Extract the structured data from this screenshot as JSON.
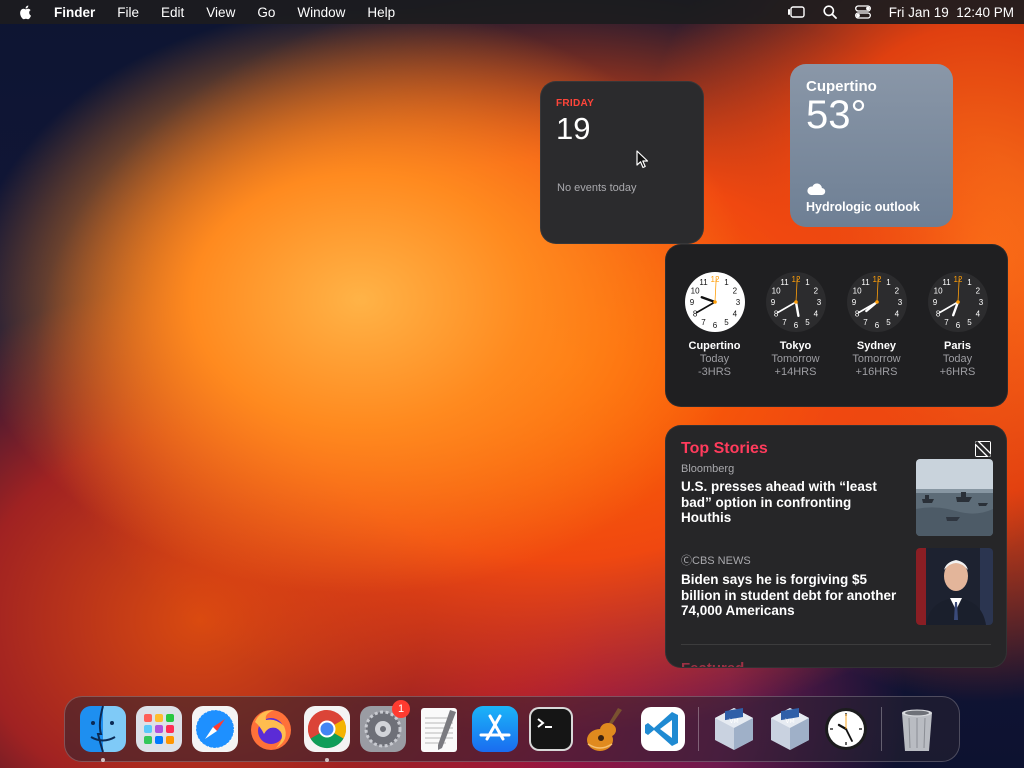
{
  "menubar": {
    "app_name": "Finder",
    "menus": [
      "File",
      "Edit",
      "View",
      "Go",
      "Window",
      "Help"
    ],
    "datetime": "Fri Jan 19  12:40 PM"
  },
  "calendar": {
    "day_name": "FRIDAY",
    "date": "19",
    "events_text": "No events today"
  },
  "weather": {
    "city": "Cupertino",
    "temperature": "53°",
    "condition_icon": "cloud-icon",
    "outlook": "Hydrologic outlook"
  },
  "world_clock": [
    {
      "city": "Cupertino",
      "day": "Today",
      "offset": "-3HRS",
      "light": true,
      "hour": 9,
      "minute": 40
    },
    {
      "city": "Tokyo",
      "day": "Tomorrow",
      "offset": "+14HRS",
      "light": false,
      "hour": 5,
      "minute": 40
    },
    {
      "city": "Sydney",
      "day": "Tomorrow",
      "offset": "+16HRS",
      "light": false,
      "hour": 7,
      "minute": 40
    },
    {
      "city": "Paris",
      "day": "Today",
      "offset": "+6HRS",
      "light": false,
      "hour": 6,
      "minute": 40
    }
  ],
  "news": {
    "heading": "Top Stories",
    "stories": [
      {
        "source": "Bloomberg",
        "headline": "U.S. presses ahead with “least bad” option in confronting Houthis"
      },
      {
        "source": "ⒸCBS NEWS",
        "headline": "Biden says he is forgiving $5 billion in student debt for another 74,000 Americans"
      }
    ],
    "featured": "Featured"
  },
  "dock": {
    "settings_badge": "1",
    "apps": [
      "finder",
      "launchpad",
      "safari",
      "firefox",
      "chrome",
      "system-settings",
      "textedit",
      "app-store",
      "terminal",
      "garageband",
      "vscode",
      "virtualbox",
      "virtualbox-2",
      "clock",
      "trash"
    ]
  },
  "colors": {
    "accent_red": "#ff453a",
    "news_pink": "#ff3b5c",
    "clock_second_hand": "#ff9f0a"
  }
}
